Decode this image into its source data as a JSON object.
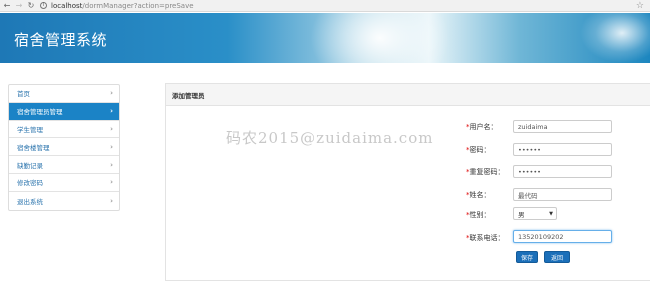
{
  "browser": {
    "url_host": "localhost",
    "url_path": "/dormManager?action=preSave"
  },
  "app": {
    "title": "宿舍管理系统"
  },
  "sidebar": {
    "items": [
      {
        "label": "首页"
      },
      {
        "label": "宿舍管理员管理",
        "active": true
      },
      {
        "label": "学生管理"
      },
      {
        "label": "宿舍楼管理"
      },
      {
        "label": "缺勤记录"
      },
      {
        "label": "修改密码"
      },
      {
        "label": "退出系统"
      }
    ]
  },
  "panel": {
    "title": "添加管理员",
    "watermark": "码农2015@zuidaima.com"
  },
  "form": {
    "required_mark": "*",
    "username_label": "用户名：",
    "username_value": "zuidaima",
    "password_label": "密码：",
    "password_value": "••••••",
    "repassword_label": "重复密码：",
    "repassword_value": "••••••",
    "name_label": "姓名：",
    "name_value": "最代码",
    "sex_label": "性别：",
    "sex_value": "男",
    "tel_label": "联系电话：",
    "tel_value": "13520109202",
    "save_label": "保存",
    "back_label": "返回"
  },
  "colors": {
    "accent": "#1b83c6",
    "required": "#dd0000",
    "button": "#1b6fb9"
  }
}
